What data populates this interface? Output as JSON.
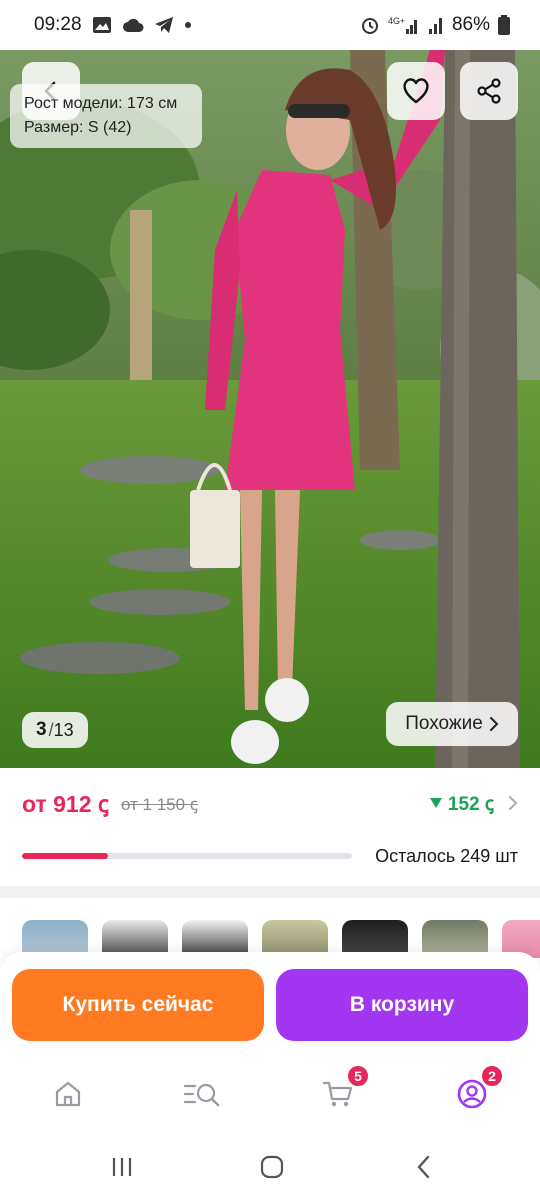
{
  "status_bar": {
    "time": "09:28",
    "network": "4G+",
    "battery": "86%"
  },
  "product": {
    "model_height": "Рост модели: 173 см",
    "model_size": "Размер: S (42)",
    "photo_current": "3",
    "photo_total": "13",
    "similar_label": "Похожие"
  },
  "price": {
    "current": "от 912 ꞔ",
    "old": "от 1 150 ꞔ",
    "cashback": "152 ꞔ",
    "stock_label": "Осталось 249 шт",
    "stock_progress_pct": 26
  },
  "actions": {
    "buy_now": "Купить сейчас",
    "add_to_cart": "В корзину"
  },
  "nav": {
    "cart_badge": "5",
    "profile_badge": "2"
  },
  "colors": {
    "price": "#e8265a",
    "cashback": "#1ca155",
    "buy_button": "#ff7a21",
    "cart_button": "#a336f0"
  },
  "icons": [
    "back-icon",
    "heart-icon",
    "share-icon",
    "chevron-right-icon",
    "home-icon",
    "catalog-search-icon",
    "cart-icon",
    "profile-icon"
  ]
}
